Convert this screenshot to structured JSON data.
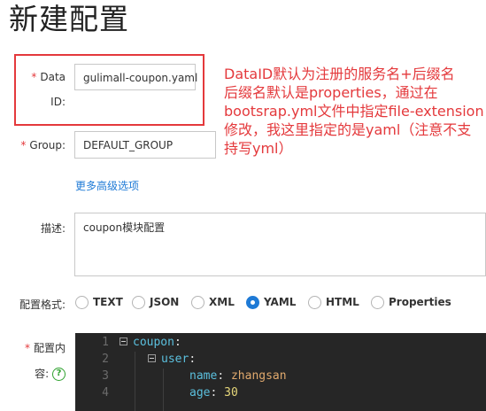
{
  "page": {
    "title": "新建配置"
  },
  "form": {
    "required_mark": "*",
    "data_id_label_line1": "Data",
    "data_id_label_line2": "ID:",
    "data_id_value": "gulimall-coupon.yaml",
    "group_label": "Group:",
    "group_value": "DEFAULT_GROUP",
    "advanced_link": "更多高级选项",
    "description_label": "描述:",
    "description_value": "coupon模块配置",
    "format_label": "配置格式:",
    "format_options": [
      "TEXT",
      "JSON",
      "XML",
      "YAML",
      "HTML",
      "Properties"
    ],
    "format_selected": "YAML",
    "content_label_line1": "配置内",
    "content_label_line2": "容:",
    "help_icon_glyph": "?"
  },
  "annotation": {
    "lines": [
      "DataID默认为注册的服务名+后缀名",
      "后缀名默认是properties，通过在",
      "bootsrap.yml文件中指定file-extension",
      "修改，我这里指定的是yaml（注意不支",
      "持写yml）"
    ],
    "color": "#e4393c"
  },
  "editor": {
    "line_numbers": [
      "1",
      "2",
      "3",
      "4"
    ],
    "lines": [
      {
        "key": "coupon",
        "sep": ":",
        "value": ""
      },
      {
        "key": "user",
        "sep": ":",
        "value": ""
      },
      {
        "key": "name",
        "sep": ": ",
        "value": "zhangsan"
      },
      {
        "key": "age",
        "sep": ": ",
        "value": "30"
      }
    ]
  },
  "colors": {
    "accent": "#1e7ad6",
    "required": "#e4393c",
    "editor_bg": "#262626",
    "help_icon": "#2ea12e"
  }
}
